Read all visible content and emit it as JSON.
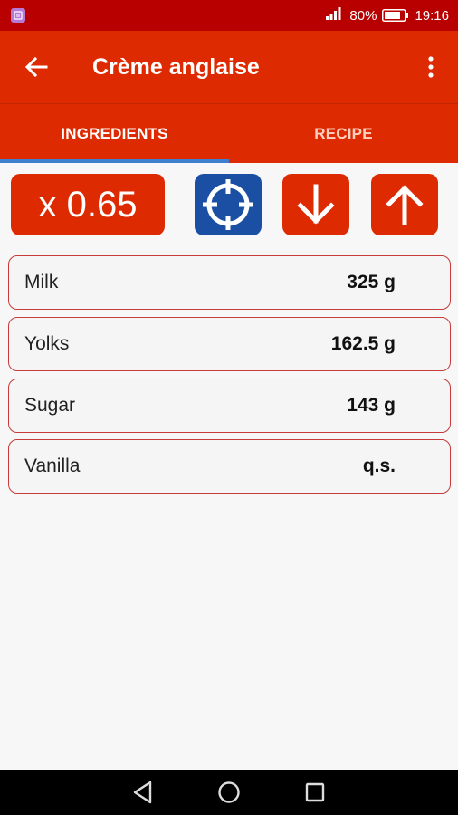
{
  "status_bar": {
    "battery_percent": "80%",
    "time": "19:16"
  },
  "app_bar": {
    "title": "Crème anglaise"
  },
  "tabs": [
    {
      "label": "INGREDIENTS",
      "active": true
    },
    {
      "label": "RECIPE",
      "active": false
    }
  ],
  "controls": {
    "factor_label": "x 0.65"
  },
  "ingredients": [
    {
      "name": "Milk",
      "quantity": "325 g"
    },
    {
      "name": "Yolks",
      "quantity": "162.5 g"
    },
    {
      "name": "Sugar",
      "quantity": "143 g"
    },
    {
      "name": "Vanilla",
      "quantity": "q.s."
    }
  ],
  "colors": {
    "primary": "#de2a00",
    "status_bar": "#b80000",
    "accent_blue": "#1a4fa3",
    "row_border": "#c63b3b"
  }
}
